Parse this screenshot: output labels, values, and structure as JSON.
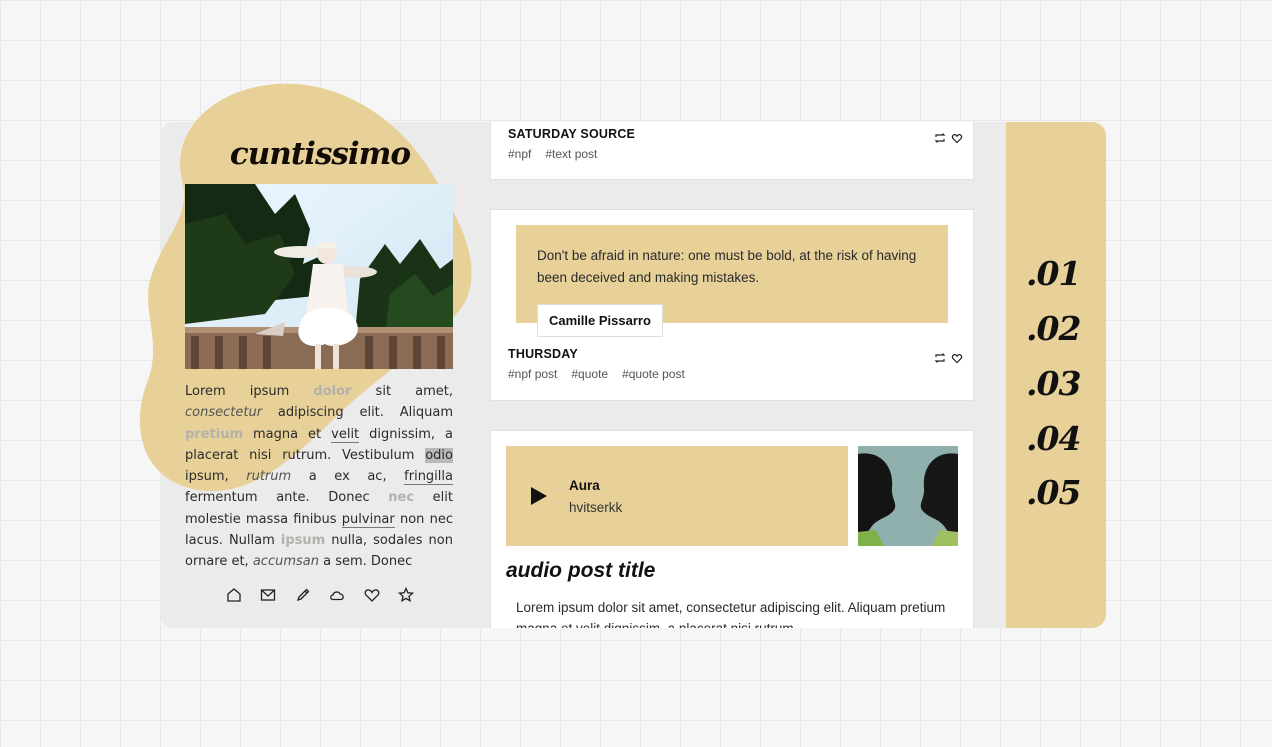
{
  "blog": {
    "title": "cuntissimo",
    "accent_color": "#e7d199",
    "bio": {
      "t1": "Lorem ipsum ",
      "f1": "dolor",
      "t2": " sit amet, ",
      "i1": "consectetur",
      "t3": " adipiscing elit. Aliquam ",
      "f2": "pretium",
      "t4": " magna et ",
      "u1": "velit",
      "t5": " dignissim, a placerat nisi rutrum. Vestibulum ",
      "h1": "odio",
      "t6": " ipsum, ",
      "i2": "rutrum",
      "t7": " a ex ac, ",
      "u2": "fringilla",
      "t8": " fermentum ante. Donec ",
      "f3": "nec",
      "t9": " elit molestie massa finibus ",
      "u3": "pulvinar",
      "t10": " non nec lacus. Nullam ",
      "f4": "ipsum",
      "t11": " nulla, sodales non ornare et, ",
      "i3": "accumsan",
      "t12": " a sem. Donec"
    },
    "icons": [
      "home-icon",
      "mail-icon",
      "pencil-icon",
      "cloud-icon",
      "heart-icon",
      "star-icon"
    ]
  },
  "posts": [
    {
      "title": "SATURDAY  SOURCE",
      "tags": [
        "#npf",
        "#text post"
      ]
    },
    {
      "quote": "Don't be afraid in nature: one must be bold, at the risk of having been deceived and making mistakes.",
      "source": "Camille Pissarro",
      "title": "THURSDAY",
      "tags": [
        "#npf post",
        "#quote",
        "#quote post"
      ]
    },
    {
      "track": "Aura",
      "artist": "hvitserkk",
      "title": "audio post title",
      "body": "Lorem ipsum dolor sit amet, consectetur adipiscing elit. Aliquam pretium magna et velit dignissim, a placerat nisi rutrum."
    }
  ],
  "nav": [
    ".01",
    ".02",
    ".03",
    ".04",
    ".05"
  ]
}
